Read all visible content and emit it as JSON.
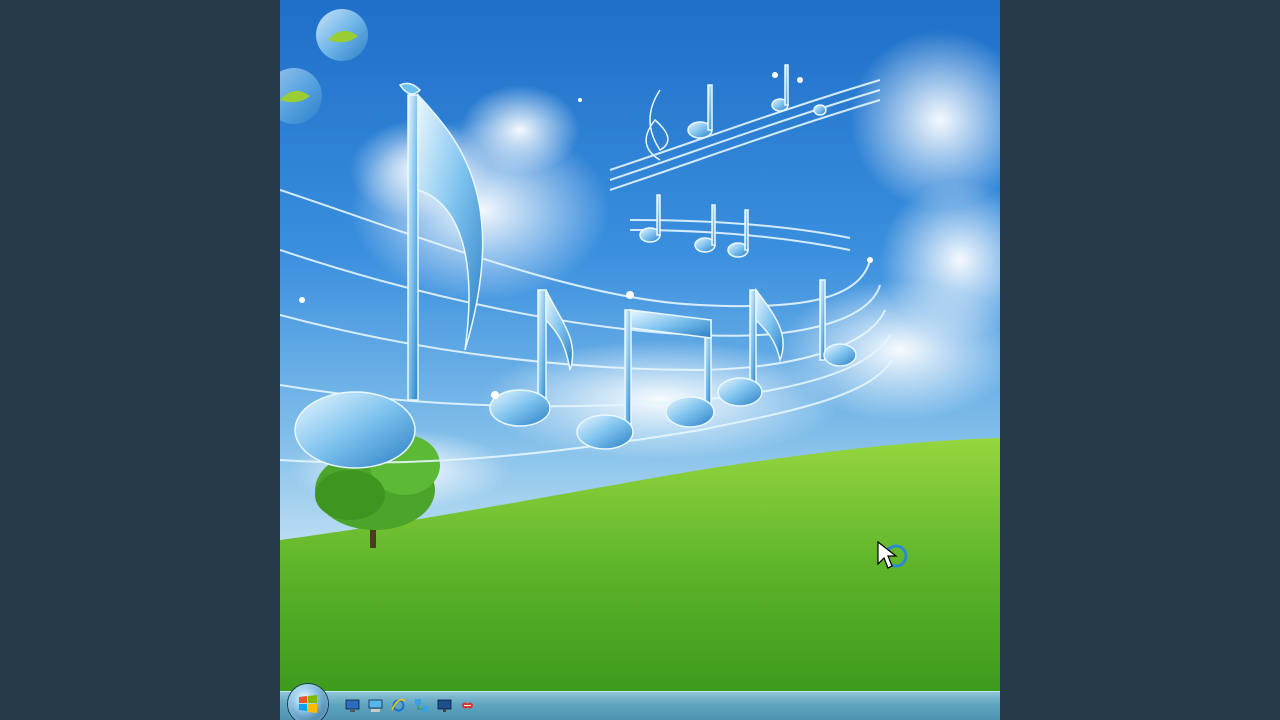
{
  "desktop": {
    "wallpaper": {
      "description_icons": [
        "music-notes",
        "clouds",
        "grass-hill",
        "tree"
      ],
      "colors": {
        "sky_top": "#1e6fc8",
        "sky_bottom": "#b9dcf3",
        "grass_light": "#8fd13b",
        "grass_dark": "#3f9a1e"
      }
    }
  },
  "taskbar": {
    "start_button": {
      "icon": "windows-logo-icon"
    },
    "quick_launch": [
      {
        "icon": "show-desktop-icon"
      },
      {
        "icon": "computer-icon"
      },
      {
        "icon": "internet-explorer-icon"
      },
      {
        "icon": "network-icon"
      },
      {
        "icon": "monitor-icon"
      },
      {
        "icon": "media-player-icon"
      }
    ]
  },
  "cursor": {
    "icon": "busy-cursor-icon"
  }
}
